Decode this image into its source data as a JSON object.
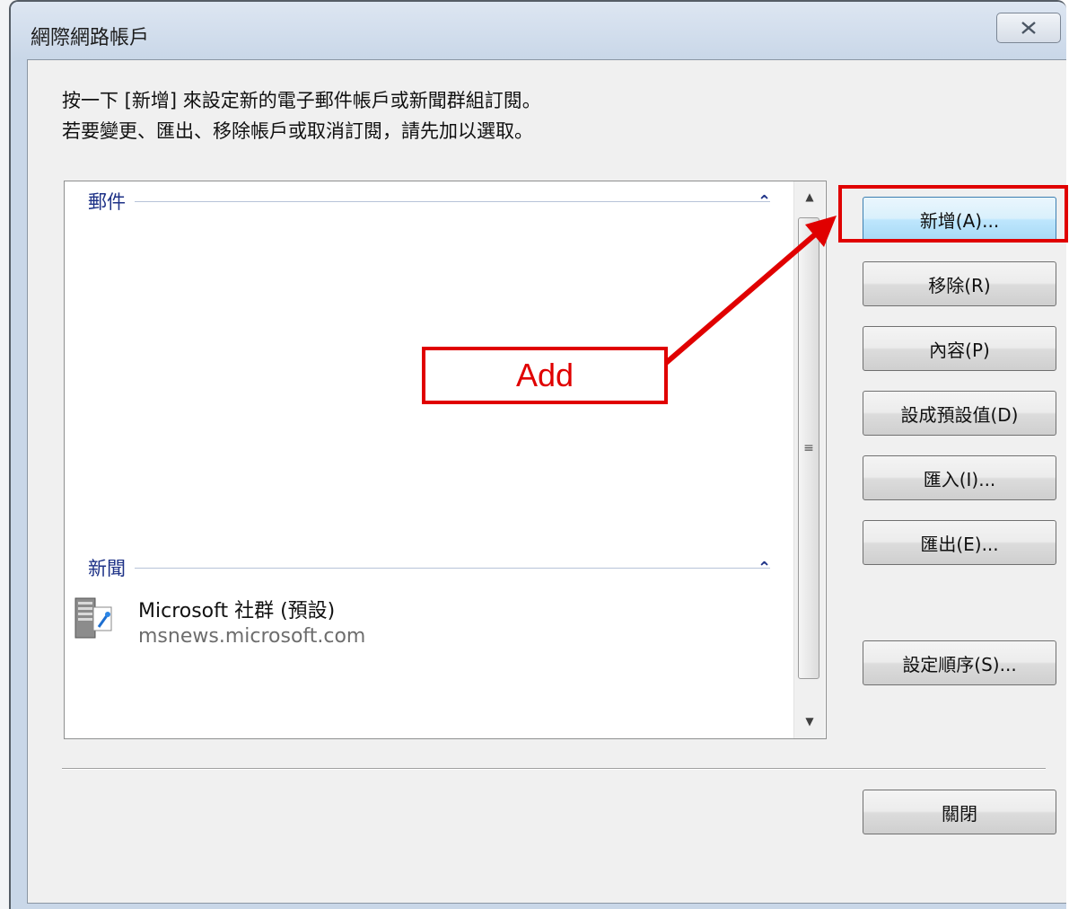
{
  "window": {
    "title": "網際網路帳戶"
  },
  "instructions": {
    "line1": "按一下 [新增] 來設定新的電子郵件帳戶或新聞群組訂閱。",
    "line2": "若要變更、匯出、移除帳戶或取消訂閱，請先加以選取。"
  },
  "account_list": {
    "mail_group_label": "郵件",
    "news_group_label": "新聞",
    "news_accounts": [
      {
        "name": "Microsoft 社群 (預設)",
        "server": "msnews.microsoft.com",
        "icon": "news-server-icon"
      }
    ]
  },
  "buttons": {
    "add": "新增(A)...",
    "remove": "移除(R)",
    "properties": "內容(P)",
    "set_default": "設成預設值(D)",
    "import": "匯入(I)...",
    "export": "匯出(E)...",
    "set_order": "設定順序(S)...",
    "close": "關閉"
  },
  "annotation": {
    "label": "Add",
    "color": "#e00000"
  }
}
